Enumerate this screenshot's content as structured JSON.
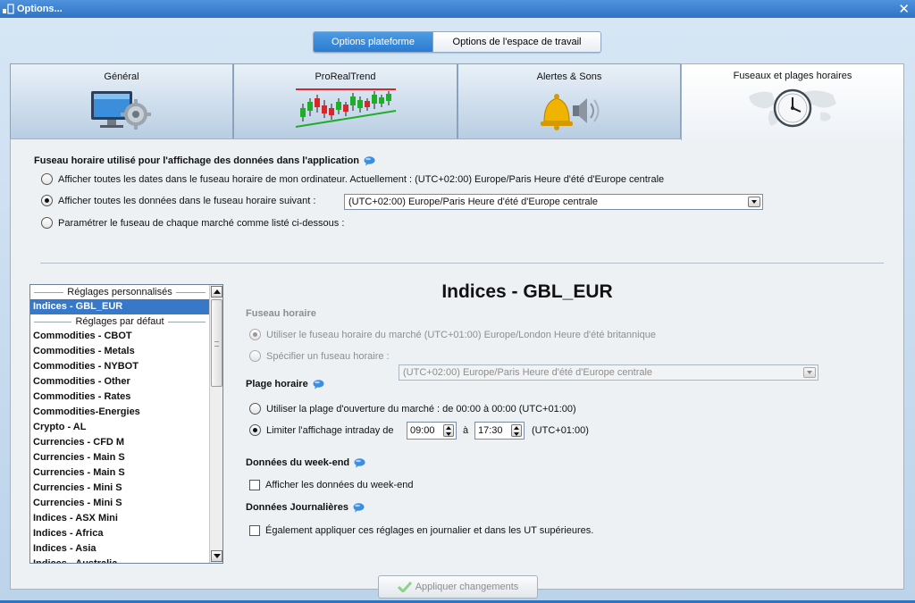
{
  "window": {
    "title": "Options..."
  },
  "segmented": {
    "active_label": "Options plateforme",
    "inactive_label": "Options de l'espace de travail"
  },
  "tabs": [
    {
      "label": "Général",
      "icon": "computer-settings-icon"
    },
    {
      "label": "ProRealTrend",
      "icon": "trend-chart-icon"
    },
    {
      "label": "Alertes & Sons",
      "icon": "bell-speaker-icon"
    },
    {
      "label": "Fuseaux et plages horaires",
      "icon": "world-clock-icon"
    }
  ],
  "timezone_section": {
    "title": "Fuseau horaire utilisé pour l'affichage des données dans l'application",
    "option1": "Afficher toutes les dates dans le fuseau horaire de mon ordinateur. Actuellement : (UTC+02:00) Europe/Paris Heure d'été d'Europe centrale",
    "option2": "Afficher toutes les données dans le fuseau horaire suivant :",
    "option2_select": "(UTC+02:00) Europe/Paris Heure d'été d'Europe centrale",
    "option3": "Paramétrer le fuseau de chaque marché comme listé ci-dessous :"
  },
  "list": {
    "header_custom": "Réglages personnalisés",
    "header_default": "Réglages par défaut",
    "selected_item": "Indices - GBL_EUR",
    "items": [
      "Commodities - CBOT",
      "Commodities - Metals",
      "Commodities - NYBOT",
      "Commodities - Other",
      "Commodities - Rates",
      "Commodities-Energies",
      "Crypto - AL",
      "Currencies - CFD M",
      "Currencies - Main S",
      "Currencies - Main S",
      "Currencies - Mini S",
      "Currencies - Mini S",
      "Indices - ASX Mini",
      "Indices - Africa",
      "Indices - Asia",
      "Indices - Australia"
    ]
  },
  "detail": {
    "title": "Indices - GBL_EUR",
    "tz_heading": "Fuseau horaire",
    "tz_option1": "Utiliser le fuseau horaire du marché (UTC+01:00) Europe/London Heure d'été britannique",
    "tz_option2": "Spécifier un fuseau horaire :",
    "tz_select": "(UTC+02:00) Europe/Paris Heure d'été d'Europe centrale",
    "range_heading": "Plage horaire",
    "range_option1": "Utiliser la plage d'ouverture du marché : de 00:00 à 00:00  (UTC+01:00)",
    "range_option2": "Limiter l'affichage intraday  de",
    "range_from": "09:00",
    "range_to_label": "à",
    "range_to": "17:30",
    "range_tz": "(UTC+01:00)",
    "weekend_heading": "Données du week-end",
    "weekend_check": "Afficher les données du week-end",
    "daily_heading": "Données Journalières",
    "daily_check": "Également appliquer ces réglages en journalier et dans les UT supérieures.",
    "apply_label": "Appliquer changements"
  },
  "colors": {
    "accent": "#2b7bd1",
    "selected": "#3878c9",
    "bell": "#f0b400",
    "trend_green": "#1fae2a",
    "trend_red": "#d8262c"
  }
}
